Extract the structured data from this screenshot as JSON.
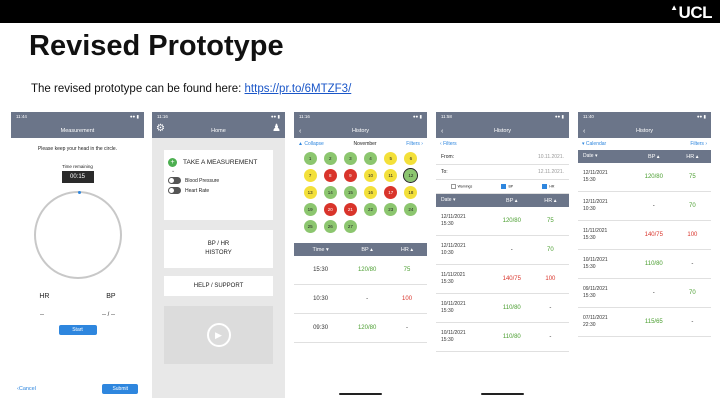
{
  "slide": {
    "title": "Revised Prototype",
    "subtitle_text": "The revised prototype can be found here: ",
    "link": "https://pr.to/6MTZF3/",
    "logo": "UCL"
  },
  "p1": {
    "time": "11:44",
    "title": "Measurement",
    "instruction": "Please keep your head in the circle.",
    "timer_label": "Time remaining",
    "timer": "00:15",
    "hr_label": "HR",
    "bp_label": "BP",
    "hr_value": "--",
    "bp_value": "-- / --",
    "start": "Start",
    "cancel": "Cancel",
    "submit": "Submit"
  },
  "p2": {
    "time": "11:16",
    "title": "Home",
    "take": "TAKE A MEASUREMENT",
    "opt1": "Blood Pressure",
    "opt2": "Heart Rate",
    "btn1_l1": "BP / HR",
    "btn1_l2": "HISTORY",
    "btn2": "HELP / SUPPORT"
  },
  "p3": {
    "time": "11:16",
    "title": "History",
    "collapse": "Collapse",
    "month": "November",
    "filters": "Filters",
    "days": [
      {
        "n": "1",
        "c": "g"
      },
      {
        "n": "2",
        "c": "g"
      },
      {
        "n": "3",
        "c": "g"
      },
      {
        "n": "4",
        "c": "g"
      },
      {
        "n": "5",
        "c": "y"
      },
      {
        "n": "6",
        "c": "y"
      },
      {
        "n": "7",
        "c": "y"
      },
      {
        "n": "8",
        "c": "r"
      },
      {
        "n": "9",
        "c": "r"
      },
      {
        "n": "10",
        "c": "y"
      },
      {
        "n": "11",
        "c": "y"
      },
      {
        "n": "12",
        "c": "g"
      },
      {
        "n": "13",
        "c": "y"
      },
      {
        "n": "14",
        "c": "g"
      },
      {
        "n": "15",
        "c": "g"
      },
      {
        "n": "16",
        "c": "y"
      },
      {
        "n": "17",
        "c": "r"
      },
      {
        "n": "18",
        "c": "y"
      },
      {
        "n": "19",
        "c": "g"
      },
      {
        "n": "20",
        "c": "r"
      },
      {
        "n": "21",
        "c": "r"
      },
      {
        "n": "22",
        "c": "g"
      },
      {
        "n": "23",
        "c": "g"
      },
      {
        "n": "24",
        "c": "g"
      },
      {
        "n": "25",
        "c": "g"
      },
      {
        "n": "26",
        "c": "g"
      },
      {
        "n": "27",
        "c": "g"
      }
    ],
    "cols": [
      "Time ▾",
      "BP ▴",
      "HR ▴"
    ],
    "rows": [
      {
        "t": "15:30",
        "bp": "120/80",
        "bpc": "green",
        "hr": "75",
        "hrc": "green"
      },
      {
        "t": "10:30",
        "bp": "-",
        "bpc": "dark",
        "hr": "100",
        "hrc": "red"
      },
      {
        "t": "09:30",
        "bp": "120/80",
        "bpc": "green",
        "hr": "-",
        "hrc": "dark"
      }
    ]
  },
  "p4": {
    "time": "11:58",
    "title": "History",
    "filters": "Filters",
    "from_label": "From:",
    "from_val": "10.11.2021.",
    "to_label": "To:",
    "to_val": "12.11.2021.",
    "checks": [
      "Warnings",
      "BP",
      "HR"
    ],
    "cols": [
      "Date ▾",
      "BP ▴",
      "HR ▴"
    ],
    "rows": [
      {
        "d1": "12/11/2021",
        "d2": "15:30",
        "bp": "120/80",
        "bpc": "green",
        "hr": "75",
        "hrc": "green"
      },
      {
        "d1": "12/11/2021",
        "d2": "10:30",
        "bp": "-",
        "bpc": "dark",
        "hr": "70",
        "hrc": "green"
      },
      {
        "d1": "11/11/2021",
        "d2": "15:30",
        "bp": "140/75",
        "bpc": "red",
        "hr": "100",
        "hrc": "red"
      },
      {
        "d1": "10/11/2021",
        "d2": "15:30",
        "bp": "110/80",
        "bpc": "green",
        "hr": "-",
        "hrc": "dark"
      },
      {
        "d1": "10/11/2021",
        "d2": "15:30",
        "bp": "110/80",
        "bpc": "green",
        "hr": "-",
        "hrc": "dark"
      }
    ]
  },
  "p5": {
    "time": "11:40",
    "title": "History",
    "calendar": "Calendar",
    "filters": "Filters",
    "cols": [
      "Date ▾",
      "BP ▴",
      "HR ▴"
    ],
    "rows": [
      {
        "d1": "12/11/2021",
        "d2": "15:30",
        "bp": "120/80",
        "bpc": "green",
        "hr": "75",
        "hrc": "green"
      },
      {
        "d1": "12/11/2021",
        "d2": "10:30",
        "bp": "-",
        "bpc": "dark",
        "hr": "70",
        "hrc": "green"
      },
      {
        "d1": "11/11/2021",
        "d2": "15:30",
        "bp": "140/75",
        "bpc": "red",
        "hr": "100",
        "hrc": "red"
      },
      {
        "d1": "10/11/2021",
        "d2": "15:30",
        "bp": "110/80",
        "bpc": "green",
        "hr": "-",
        "hrc": "dark"
      },
      {
        "d1": "09/11/2021",
        "d2": "15:30",
        "bp": "-",
        "bpc": "dark",
        "hr": "70",
        "hrc": "green"
      },
      {
        "d1": "07/11/2021",
        "d2": "22:30",
        "bp": "115/65",
        "bpc": "green",
        "hr": "-",
        "hrc": "dark"
      }
    ]
  }
}
